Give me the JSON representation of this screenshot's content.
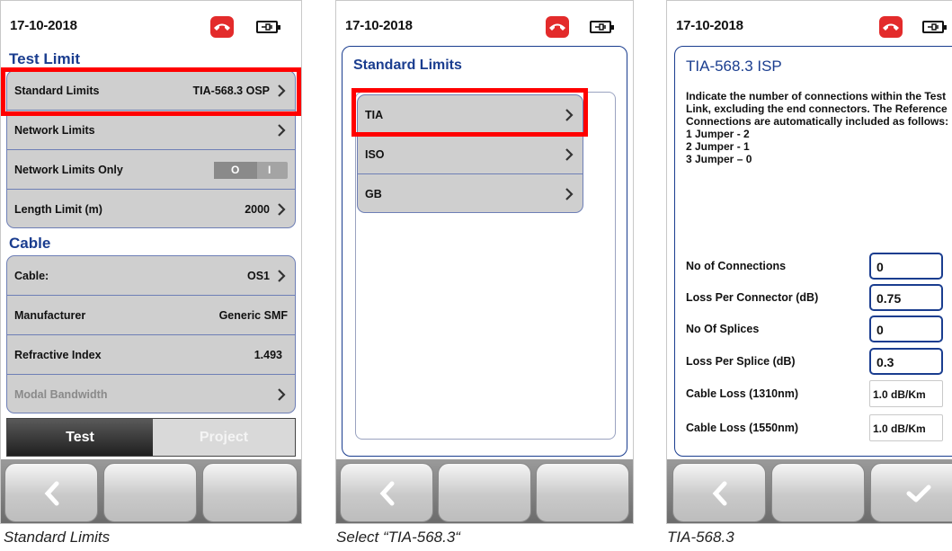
{
  "screens": [
    {
      "date": "17-10-2018",
      "test_limit": {
        "title": "Test Limit",
        "rows": [
          {
            "label": "Standard Limits",
            "value": "TIA-568.3 OSP"
          },
          {
            "label": "Network Limits",
            "value": ""
          },
          {
            "label": "Network Limits Only",
            "toggle_on": "O",
            "toggle_off": "I",
            "state": "off"
          },
          {
            "label": "Length Limit (m)",
            "value": "2000"
          }
        ]
      },
      "cable": {
        "title": "Cable",
        "rows": [
          {
            "label": "Cable:",
            "value": "OS1"
          },
          {
            "label": "Manufacturer",
            "value": "Generic SMF"
          },
          {
            "label": "Refractive Index",
            "value": "1.493"
          },
          {
            "label": "Modal Bandwidth",
            "value": "",
            "disabled": true
          }
        ]
      },
      "tabs": {
        "test": "Test",
        "project": "Project"
      },
      "caption": "Standard Limits"
    },
    {
      "date": "17-10-2018",
      "panel_title": "Standard Limits",
      "items": [
        "TIA",
        "ISO",
        "GB"
      ],
      "caption": "Select “TIA-568.3“"
    },
    {
      "date": "17-10-2018",
      "panel_title": "TIA-568.3 ISP",
      "description": "Indicate the number of connections within the Test Link, excluding the end connectors. The Reference Connections are automatically included as follows:",
      "jumpers": [
        "1 Jumper - 2",
        "2 Jumper - 1",
        "3 Jumper – 0"
      ],
      "fields": [
        {
          "label": "No of Connections",
          "value": "0",
          "editable": true
        },
        {
          "label": "Loss Per Connector (dB)",
          "value": "0.75",
          "editable": true
        },
        {
          "label": "No Of Splices",
          "value": "0",
          "editable": true
        },
        {
          "label": "Loss Per Splice (dB)",
          "value": "0.3",
          "editable": true
        },
        {
          "label": "Cable Loss (1310nm)",
          "value": "1.0 dB/Km",
          "editable": false
        },
        {
          "label": "Cable Loss (1550nm)",
          "value": "1.0 dB/Km",
          "editable": false
        }
      ],
      "caption": "TIA-568.3"
    }
  ],
  "colors": {
    "accent": "#1a3d8f",
    "highlight": "#ff0000",
    "phone": "#e32b2b"
  },
  "icons": [
    "phone-hangup-icon",
    "battery-plug-icon",
    "chevron-right-icon",
    "back-arrow-icon",
    "checkmark-icon"
  ]
}
